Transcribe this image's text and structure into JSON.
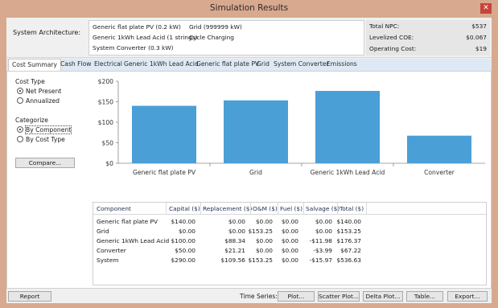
{
  "window": {
    "title": "Simulation Results"
  },
  "architecture": {
    "label": "System Architecture:",
    "items": [
      "Generic flat plate PV (0.2 kW)",
      "Generic 1kWh Lead Acid (1 strings)",
      "System Converter (0.3 kW)",
      "Grid (999999 kW)",
      "Cycle Charging"
    ]
  },
  "summary": {
    "rows": [
      {
        "label": "Total NPC:",
        "value": "$537"
      },
      {
        "label": "Levelized COE:",
        "value": "$0.067"
      },
      {
        "label": "Operating Cost:",
        "value": "$19"
      }
    ]
  },
  "tabs": [
    "Cost Summary",
    "Cash Flow",
    "Electrical",
    "Generic 1kWh Lead Acid",
    "Generic flat plate PV",
    "Grid",
    "System Converter",
    "Emissions"
  ],
  "cost_type": {
    "label": "Cost Type",
    "options": [
      "Net Present",
      "Annualized"
    ],
    "selected": 0
  },
  "categorize": {
    "label": "Categorize",
    "options": [
      "By Component",
      "By Cost Type"
    ],
    "selected": 0
  },
  "compare_label": "Compare...",
  "chart_data": {
    "type": "bar",
    "categories": [
      "Generic flat plate PV",
      "Grid",
      "Generic 1kWh Lead Acid",
      "Converter"
    ],
    "values": [
      140.0,
      153.25,
      176.37,
      67.22
    ],
    "yticks": [
      "$0",
      "$50",
      "$100",
      "$150",
      "$200"
    ],
    "ylim": [
      0,
      200
    ],
    "bar_color": "#4a9fd6",
    "grid": false
  },
  "table": {
    "columns": [
      "Component",
      "Capital ($)",
      "Replacement ($)",
      "O&M ($)",
      "Fuel ($)",
      "Salvage ($)",
      "Total ($)"
    ],
    "rows": [
      [
        "Generic flat plate PV",
        "$140.00",
        "$0.00",
        "$0.00",
        "$0.00",
        "$0.00",
        "$140.00"
      ],
      [
        "Grid",
        "$0.00",
        "$0.00",
        "$153.25",
        "$0.00",
        "$0.00",
        "$153.25"
      ],
      [
        "Generic 1kWh Lead Acid",
        "$100.00",
        "$88.34",
        "$0.00",
        "$0.00",
        "-$11.98",
        "$176.37"
      ],
      [
        "Converter",
        "$50.00",
        "$21.21",
        "$0.00",
        "$0.00",
        "-$3.99",
        "$67.22"
      ],
      [
        "System",
        "$290.00",
        "$109.56",
        "$153.25",
        "$0.00",
        "-$15.97",
        "$536.63"
      ]
    ]
  },
  "bottom": {
    "report_label": "Report",
    "time_series_label": "Time Series:",
    "buttons": [
      "Plot...",
      "Scatter Plot...",
      "Delta Plot...",
      "Table...",
      "Export..."
    ]
  },
  "colors": {
    "titlebar": "#d8a98e",
    "close": "#c9433a",
    "tabstrip": "#dfe9f5",
    "bar": "#4a9fd6"
  }
}
